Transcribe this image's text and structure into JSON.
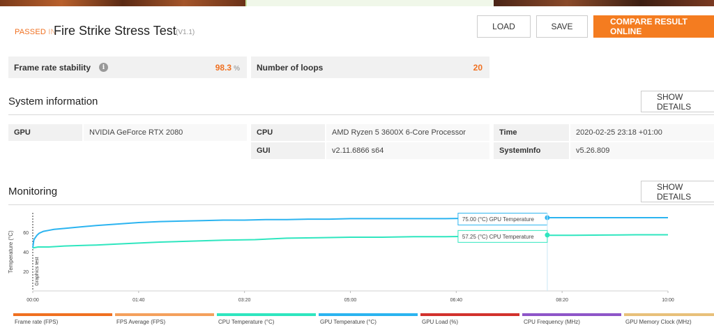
{
  "header": {
    "passed_label": "PASSED",
    "passed_in": "IN",
    "test_title": "Fire Strike Stress Test",
    "version": "(V1.1)",
    "buttons": {
      "load": "LOAD",
      "save": "SAVE",
      "compare": "COMPARE RESULT ONLINE"
    }
  },
  "stats": {
    "frame_rate_stability": {
      "label": "Frame rate stability",
      "value": "98.3",
      "unit": "%",
      "info_icon": "info-icon"
    },
    "loops": {
      "label": "Number of loops",
      "value": "20"
    }
  },
  "system_info": {
    "title": "System information",
    "show_details": "SHOW DETAILS",
    "rows": [
      {
        "key": "GPU",
        "value": "NVIDIA GeForce RTX 2080"
      },
      {
        "key": "CPU",
        "value": "AMD Ryzen 5 3600X 6-Core Processor"
      },
      {
        "key": "GUI",
        "value": "v2.11.6866 s64"
      },
      {
        "key": "Time",
        "value": "2020-02-25 23:18 +01:00"
      },
      {
        "key": "SystemInfo",
        "value": "v5.26.809"
      }
    ]
  },
  "monitoring": {
    "title": "Monitoring",
    "show_details": "SHOW DETAILS"
  },
  "chart_data": {
    "type": "line",
    "ylabel": "Temperature (°C)",
    "ylim": [
      0,
      80
    ],
    "y_ticks": [
      "20",
      "40",
      "60"
    ],
    "x_ticks": [
      "00:00",
      "01:40",
      "03:20",
      "05:00",
      "06:40",
      "08:20",
      "10:00"
    ],
    "xlim_seconds": [
      0,
      600
    ],
    "marker_label": "Graphics test",
    "series": [
      {
        "name": "GPU Temperature",
        "color": "#2bb4f0",
        "x": [
          0,
          1,
          2,
          4,
          6,
          10,
          15,
          20,
          30,
          45,
          60,
          80,
          100,
          120,
          140,
          160,
          180,
          200,
          220,
          240,
          260,
          280,
          300,
          330,
          360,
          390,
          420,
          450,
          480,
          510,
          540,
          570,
          600
        ],
        "values": [
          44,
          52,
          54,
          57,
          59,
          61,
          62,
          63,
          64,
          65.5,
          67,
          68.5,
          70,
          71,
          71.5,
          72,
          72.5,
          72.5,
          73,
          73,
          73.5,
          73.5,
          74,
          74,
          74,
          74,
          74.5,
          74.5,
          75,
          75,
          75,
          75,
          75
        ]
      },
      {
        "name": "CPU Temperature",
        "color": "#2fe6bf",
        "x": [
          0,
          5,
          15,
          30,
          45,
          60,
          80,
          100,
          120,
          150,
          180,
          210,
          240,
          270,
          300,
          330,
          360,
          390,
          420,
          450,
          480,
          510,
          540,
          570,
          600
        ],
        "values": [
          44,
          45,
          45,
          46,
          46.5,
          47,
          48,
          49,
          50,
          51,
          52,
          52.5,
          54,
          54.5,
          55,
          55,
          55.5,
          55.5,
          56,
          56.5,
          57,
          57,
          57.25,
          57.5,
          57.5
        ]
      }
    ],
    "annotations": [
      {
        "text": "75.00 (°C) GPU Temperature",
        "x": 486,
        "y": 75.0,
        "series": "GPU Temperature"
      },
      {
        "text": "57.25 (°C) CPU Temperature",
        "x": 486,
        "y": 57.25,
        "series": "CPU Temperature"
      }
    ],
    "legend": [
      {
        "name": "Frame rate (FPS)",
        "color": "#f07020"
      },
      {
        "name": "FPS Average (FPS)",
        "color": "#f4a05c"
      },
      {
        "name": "CPU Temperature (°C)",
        "color": "#2fe6bf"
      },
      {
        "name": "GPU Temperature (°C)",
        "color": "#2bb4f0"
      },
      {
        "name": "GPU Load (%)",
        "color": "#d2322d"
      },
      {
        "name": "CPU Frequency (MHz)",
        "color": "#8e55c8"
      },
      {
        "name": "GPU Memory Clock (MHz)",
        "color": "#e8c07a"
      }
    ]
  }
}
